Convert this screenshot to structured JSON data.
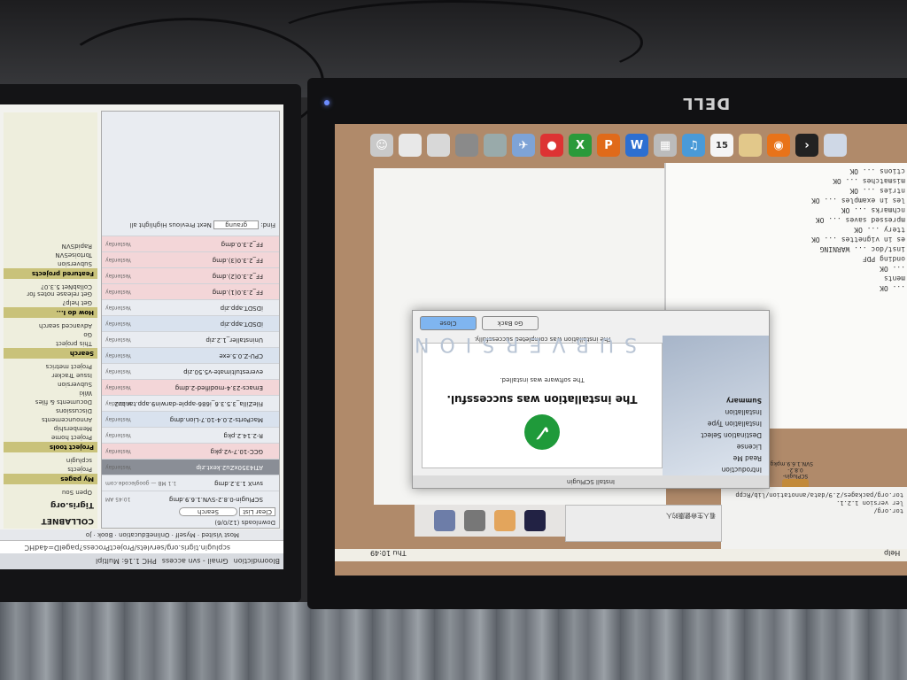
{
  "left_screen": {
    "tabs": [
      "Bloomdiction",
      "Gmail - svn access",
      "PHC 1.16: Multipl"
    ],
    "url": "scplugin.tigris.org/servlets/ProjectProcess?pageID=4adHC",
    "bookmarks": [
      "Most Visited",
      "Myself",
      "OnlineEducation",
      "Book",
      "Jo"
    ],
    "downloads": {
      "title": "Downloads (12/0/6)",
      "clear": "Clear List",
      "search_placeholder": "Search",
      "items": [
        {
          "name": "SCPlugin-0.8.2-SVN.1.6.9.dmg",
          "status": "10:45 AM"
        },
        {
          "name": "svnX 1.3.2.dmg",
          "status": "1.1 MB — googlecode.com"
        },
        {
          "name": "ATI4350xZu2.kext.zip",
          "status": "Yesterday"
        },
        {
          "name": "GCC-10.7-v2.pkg",
          "status": "Yesterday"
        },
        {
          "name": "R-2.14.2.pkg",
          "status": "Yesterday"
        },
        {
          "name": "MacPorts-2.0.4-10.7-Lion.dmg",
          "status": "Yesterday"
        },
        {
          "name": "FileZilla_3.5.3.6_i686-apple-darwin9.app.tar.bz2",
          "status": "Yesterday"
        },
        {
          "name": "Emacs-23.4-modified-2.dmg",
          "status": "Yesterday"
        },
        {
          "name": "everestultimate-v5.50.zip",
          "status": "Yesterday"
        },
        {
          "name": "CPU-Z.0.5.exe",
          "status": "Yesterday"
        },
        {
          "name": "Uninstaller_1.2.zip",
          "status": "Yesterday"
        },
        {
          "name": "iDSDT.app.zip",
          "status": "Yesterday"
        },
        {
          "name": "iDSDT.app.zip",
          "status": "Yesterday"
        },
        {
          "name": "FF_2.3.0(1).dmg",
          "status": "Yesterday"
        },
        {
          "name": "FF_2.3.0(2).dmg",
          "status": "Yesterday"
        },
        {
          "name": "FF_2.3.0(3).dmg",
          "status": "Yesterday"
        },
        {
          "name": "FF_2.3.0.dmg",
          "status": "Yesterday"
        }
      ]
    },
    "sidebar": {
      "logo": "COLLABNET",
      "site": "Tigris.org",
      "tag": "Open Sou",
      "sections": [
        {
          "title": "My pages",
          "items": [
            "Projects",
            "scplugin"
          ]
        },
        {
          "title": "Project tools",
          "items": [
            "Project home",
            "Membership",
            "Announcements",
            "Discussions",
            "Documents & files",
            "Wiki",
            "Subversion",
            "Issue Tracker",
            "Project metrics"
          ]
        },
        {
          "title": "Search",
          "items": [
            "This project",
            "Go",
            "Advanced search"
          ]
        },
        {
          "title": "How do I...",
          "items": [
            "Get help?",
            "Get release notes for CollabNet 5.3.0?"
          ]
        },
        {
          "title": "Featured projects",
          "items": [
            "Subversion",
            "TortoiseSVN",
            "RapidSVN"
          ]
        }
      ]
    },
    "find": {
      "label": "Find:",
      "value": "graung",
      "next": "Next",
      "previous": "Previous",
      "highlight": "Highlight all"
    }
  },
  "right_screen": {
    "brand": "DELL",
    "installer": {
      "title": "Install SCPlugin",
      "steps": [
        "Introduction",
        "Read Me",
        "License",
        "Destination Select",
        "Installation Type",
        "Installation",
        "Summary"
      ],
      "heading": "The installation was successful.",
      "subtext": "The software was installed.",
      "status_top": "The installation was completed successfully.",
      "brand": "SUBVERSION",
      "go_back": "Go Back",
      "close": "Close"
    },
    "package_label": "SCPlugin-0.8.2-SVN.1.6.9.mpkg",
    "terminal_lines": [
      "... OK",
      "ments",
      "... OK",
      "onding PDF",
      "inst/doc ... WARNING",
      "es in vignettes ... OK",
      "ttery ... OK",
      "mpressed saves ... OK",
      "nchmarks ... OK",
      "les in examples ... OK",
      "ntries ... OK",
      "mismatches ... OK",
      "ctions ... OK"
    ],
    "terminal2_lines": [
      "tor.org/",
      "ler version 1.2.1.",
      "tor.org/packages/2.9/data/annotation/lib/Rcpp"
    ],
    "chat_title": "看人生命健康的人",
    "menubar": {
      "clock": "Thu 10:49",
      "help": "Help"
    }
  }
}
